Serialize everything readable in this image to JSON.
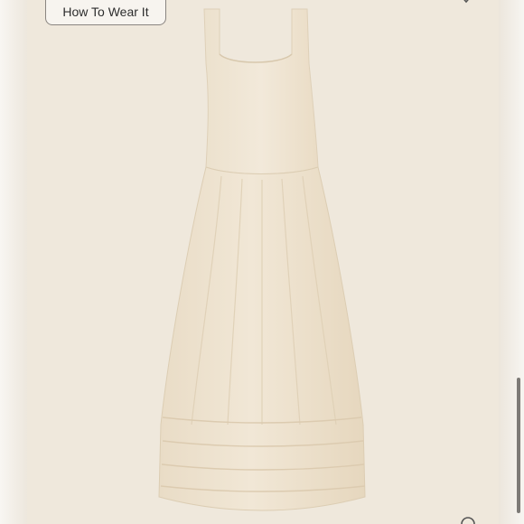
{
  "product_view": {
    "how_to_wear_label": "How To Wear It"
  },
  "icons": {
    "favorite": "heart-icon",
    "corner": "circle-icon"
  },
  "colors": {
    "background": "#efe8dc",
    "dress_fabric": "#efe3cf",
    "button_border": "#8a8580",
    "scrollbar": "#7d7a76"
  }
}
